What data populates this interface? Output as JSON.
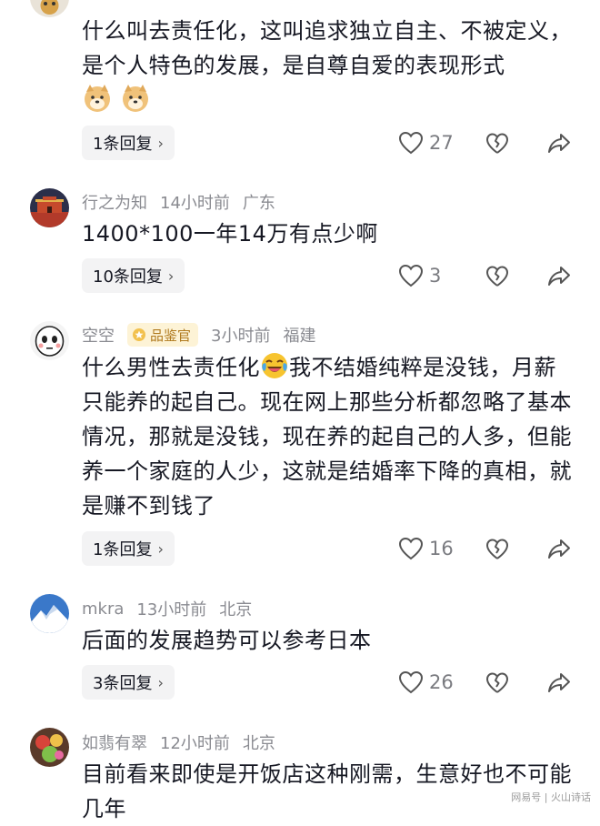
{
  "comments": [
    {
      "text": "什么叫去责任化，这叫追求独立自主、不被定义，是个人特色的发展，是自尊自爱的表现形式",
      "emoji": "doge-emoji",
      "replies": "1条回复",
      "likes": "27"
    },
    {
      "nick": "行之为知",
      "time": "14小时前",
      "location": "广东",
      "text": "1400*100一年14万有点少啊",
      "replies": "10条回复",
      "likes": "3"
    },
    {
      "nick": "空空",
      "badge": "品鉴官",
      "time": "3小时前",
      "location": "福建",
      "text_before_emoji": "什么男性去责任化",
      "text_after_emoji": "我不结婚纯粹是没钱，月薪只能养的起自己。现在网上那些分析都忽略了基本情况，那就是没钱，现在养的起自己的人多，但能养一个家庭的人少，这就是结婚率下降的真相，就是赚不到钱了",
      "replies": "1条回复",
      "likes": "16"
    },
    {
      "nick": "mkra",
      "time": "13小时前",
      "location": "北京",
      "text": "后面的发展趋势可以参考日本",
      "replies": "3条回复",
      "likes": "26"
    },
    {
      "nick": "如翡有翠",
      "time": "12小时前",
      "location": "北京",
      "text": "目前看来即使是开饭店这种刚需，生意好也不可能几年"
    }
  ],
  "watermark": "网易号 | 火山诗话",
  "colors": {
    "text": "#161823",
    "meta": "#8a8b91",
    "pill_bg": "#f3f3f4",
    "badge_bg": "#fdf3d6",
    "badge_fg": "#b07a1e"
  }
}
